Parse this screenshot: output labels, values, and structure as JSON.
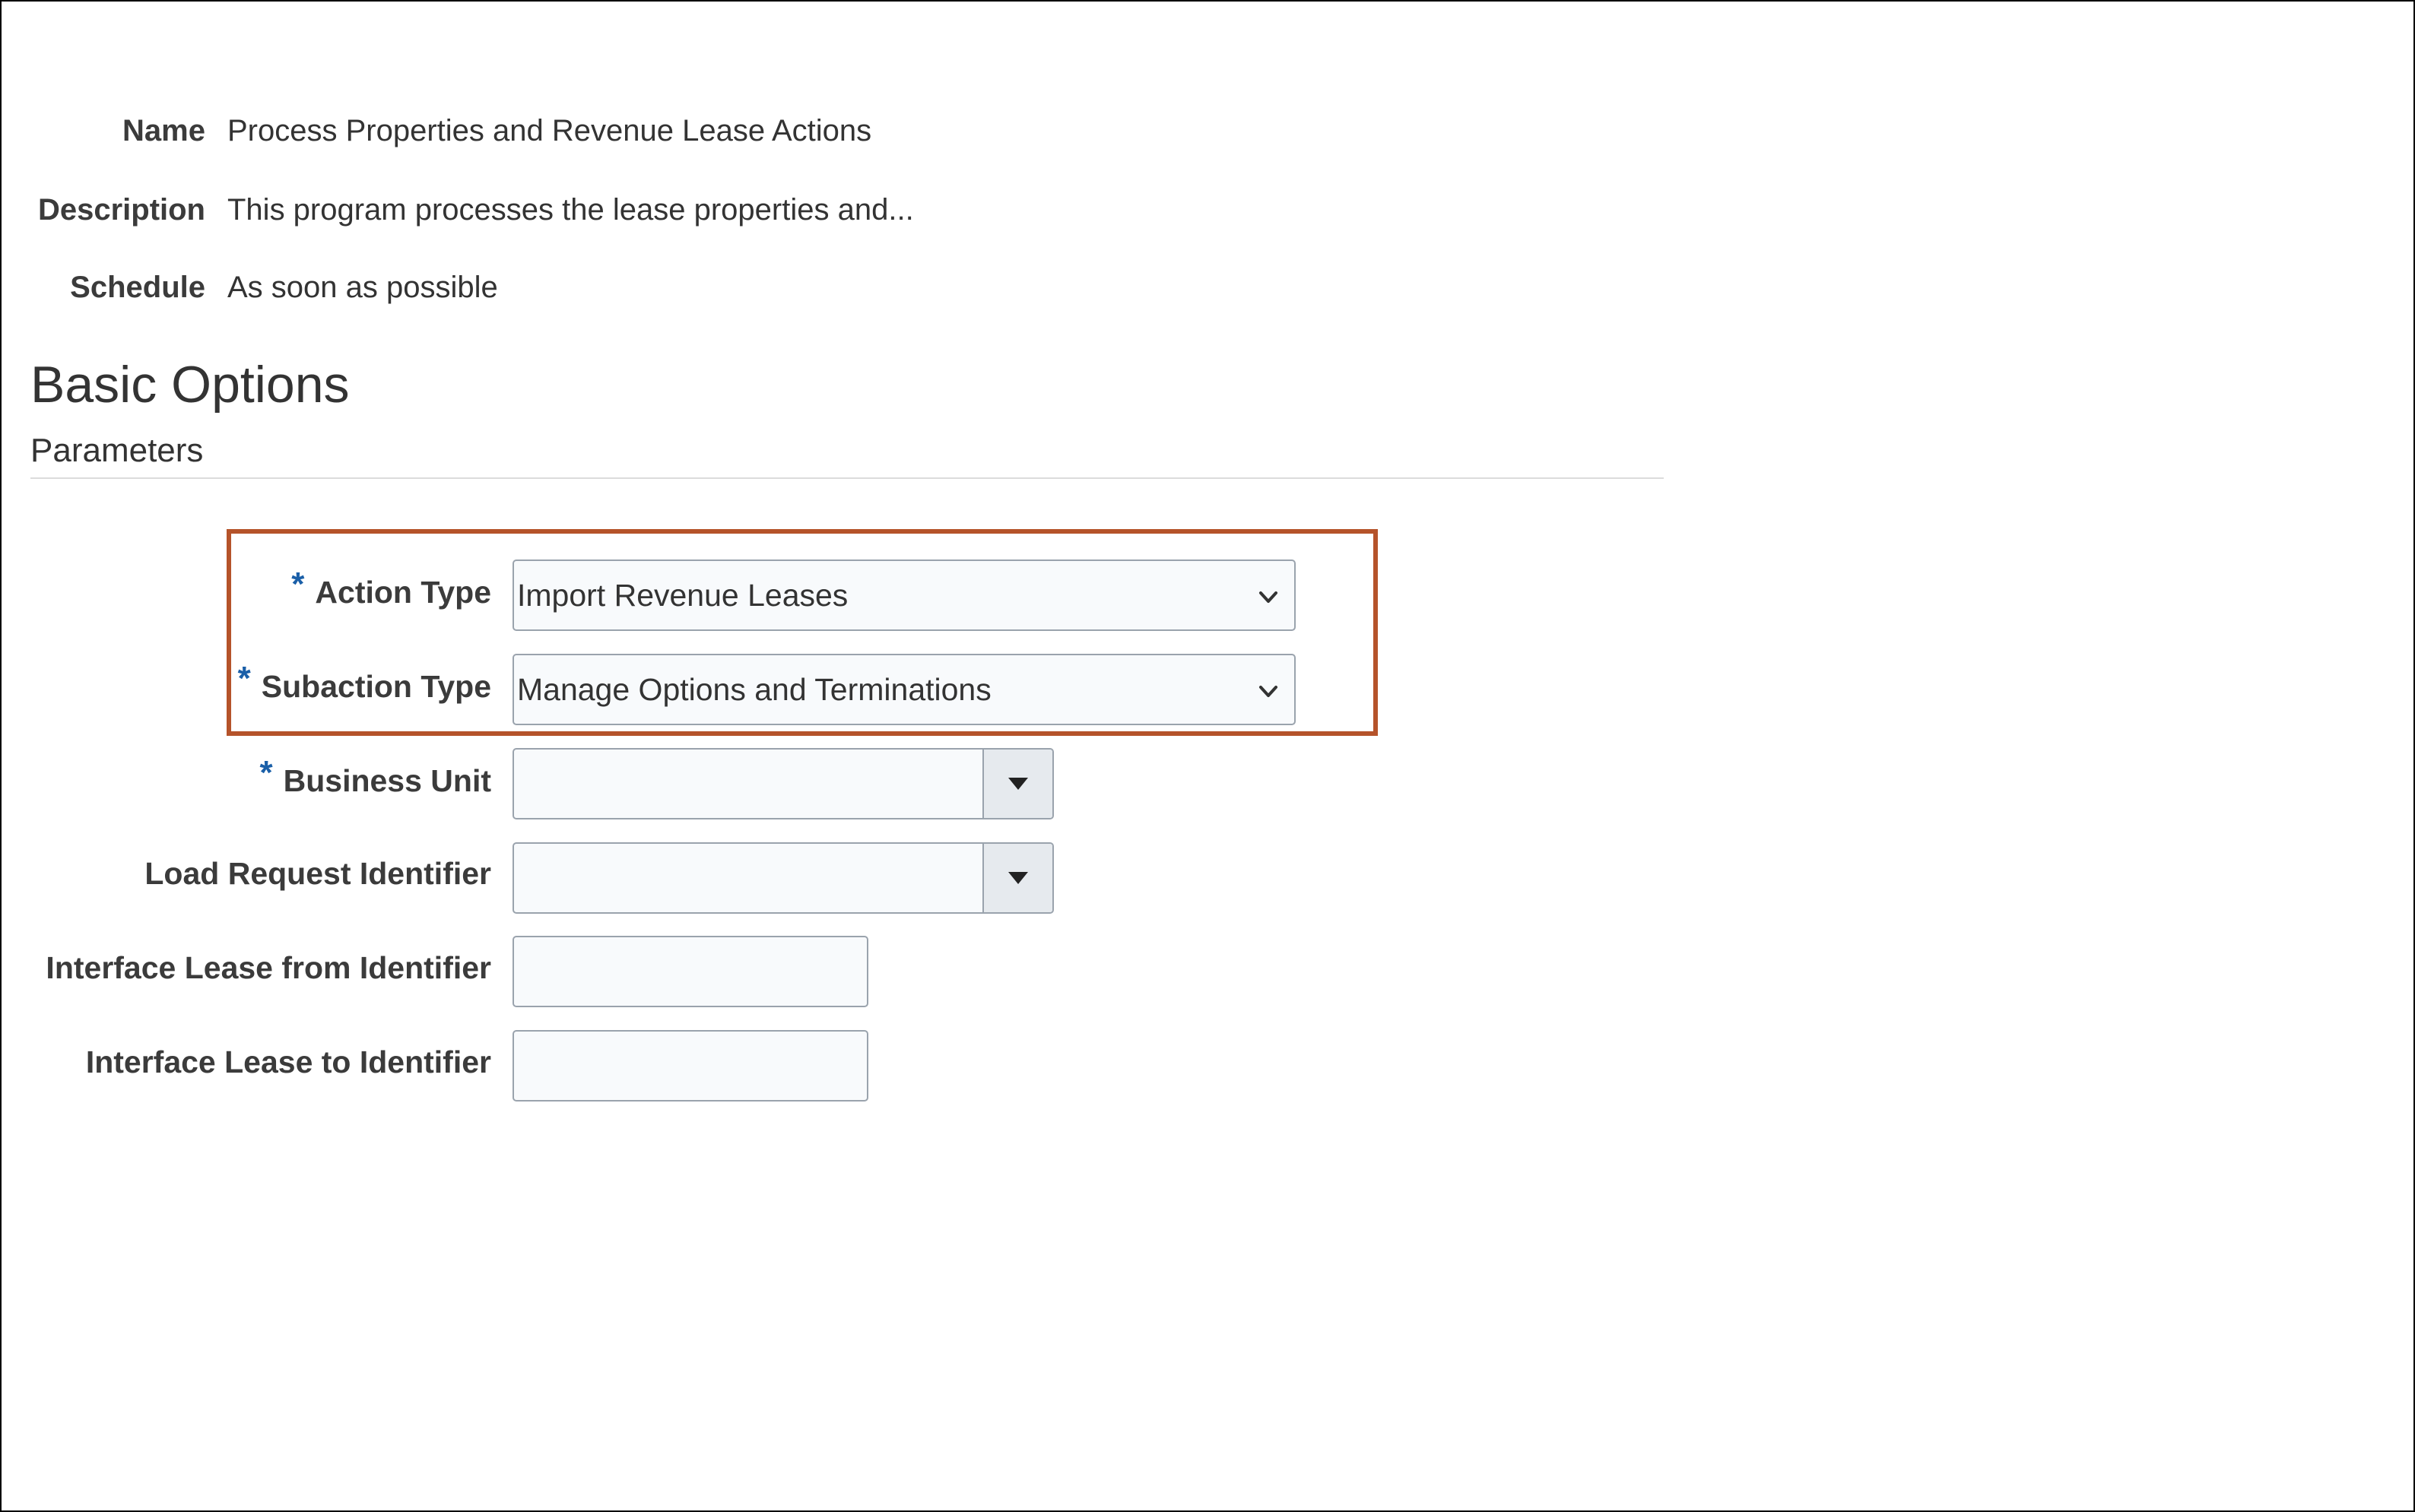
{
  "info": {
    "name_label": "Name",
    "name_value": "Process Properties and Revenue Lease Actions",
    "description_label": "Description",
    "description_value": "This program processes the lease properties and...",
    "schedule_label": "Schedule",
    "schedule_value": "As soon as possible"
  },
  "section": {
    "title": "Basic Options",
    "subtitle": "Parameters"
  },
  "parameters": {
    "action_type": {
      "label": "Action Type",
      "required": true,
      "value": "Import Revenue Leases",
      "icon": "chevron-down-icon"
    },
    "subaction_type": {
      "label": "Subaction Type",
      "required": true,
      "value": "Manage Options and Terminations",
      "icon": "chevron-down-icon"
    },
    "business_unit": {
      "label": "Business Unit",
      "required": true,
      "value": "",
      "icon": "caret-down-icon"
    },
    "load_request_identifier": {
      "label": "Load Request Identifier",
      "required": false,
      "value": "",
      "icon": "caret-down-icon"
    },
    "interface_lease_from": {
      "label": "Interface Lease from Identifier",
      "required": false,
      "value": ""
    },
    "interface_lease_to": {
      "label": "Interface Lease to Identifier",
      "required": false,
      "value": ""
    }
  },
  "required_marker": "*",
  "colors": {
    "highlight_border": "#b5532a",
    "required_marker": "#1a5fa8",
    "field_background": "#f8fafc",
    "field_border": "#9aa3ad"
  }
}
